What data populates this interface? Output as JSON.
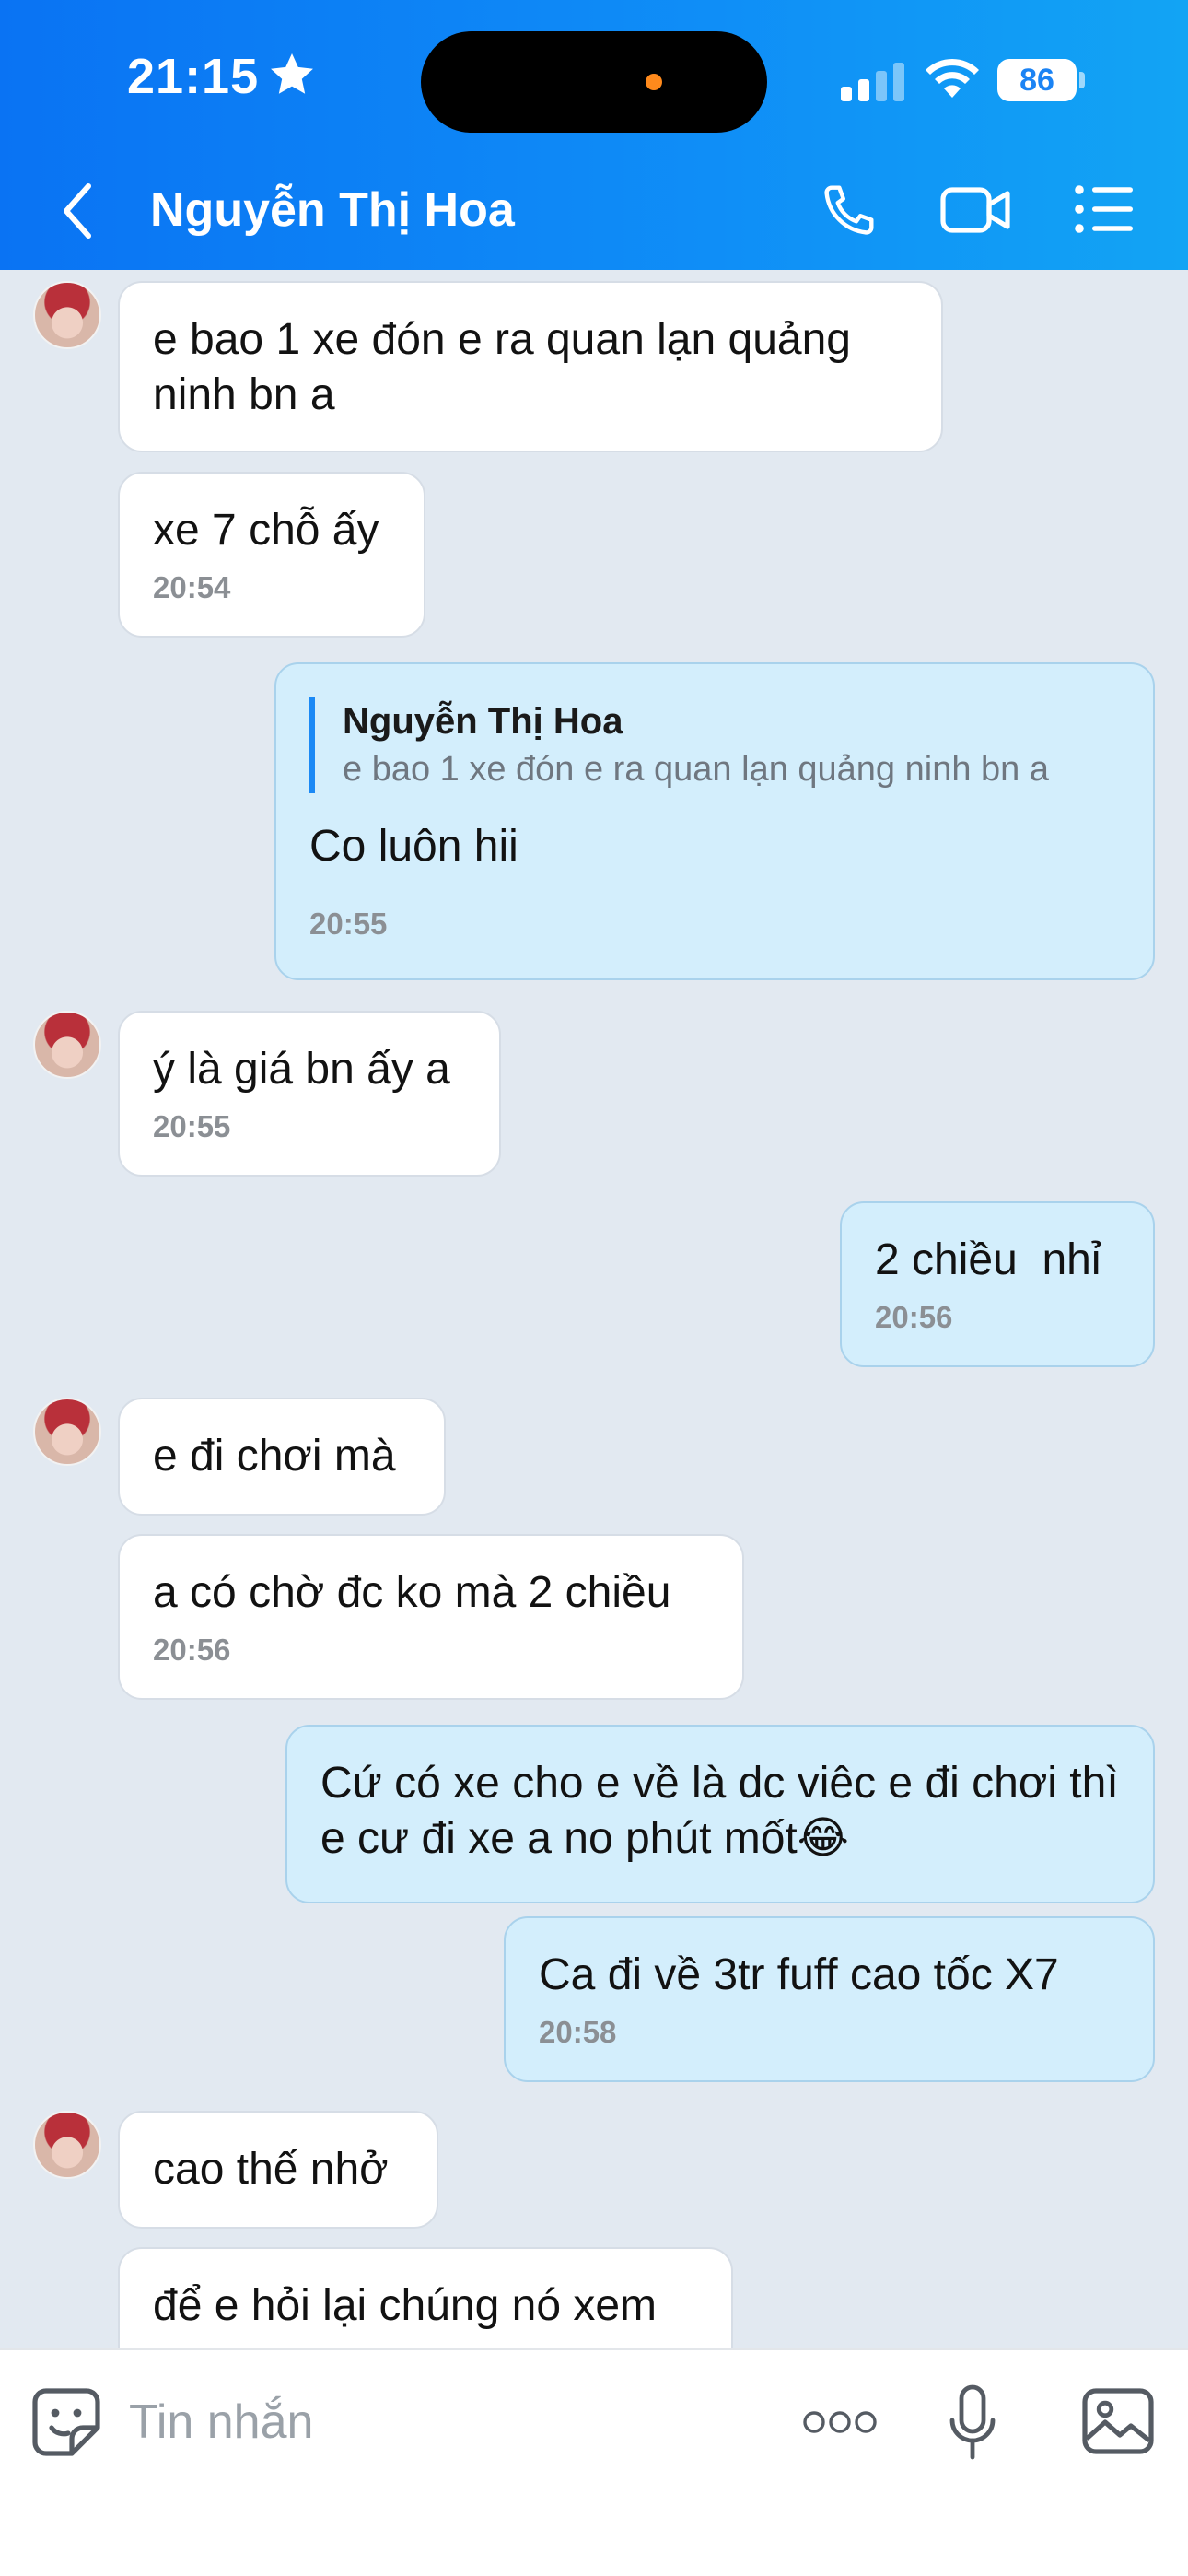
{
  "status_bar": {
    "time": "21:15",
    "battery": "86",
    "icons": [
      "star-icon",
      "signal-icon",
      "wifi-icon",
      "battery-icon"
    ]
  },
  "header": {
    "contact_name": "Nguyễn Thị Hoa",
    "icons": [
      "back-chevron-icon",
      "phone-icon",
      "video-camera-icon",
      "list-menu-icon"
    ]
  },
  "messages": [
    {
      "side": "in",
      "text": "e bao 1 xe đón e ra quan lạn quảng ninh bn a",
      "time": ""
    },
    {
      "side": "in",
      "text": "xe 7 chỗ ấy",
      "time": "20:54"
    },
    {
      "side": "out",
      "quote_name": "Nguyễn Thị Hoa",
      "quote_text": "e bao 1 xe đón e ra quan lạn quảng ninh bn a",
      "text": "Co luôn hii",
      "time": "20:55"
    },
    {
      "side": "in",
      "text": "ý là giá bn ấy a",
      "time": "20:55"
    },
    {
      "side": "out",
      "text": "2 chiều  nhỉ",
      "time": "20:56"
    },
    {
      "side": "in",
      "text": "e đi chơi mà",
      "time": ""
    },
    {
      "side": "in",
      "text": "a có chờ đc ko mà 2 chiều",
      "time": "20:56"
    },
    {
      "side": "out",
      "text": "Cứ có xe cho e về là dc viêc e đi chơi thì e cư đi xe a no phút mốt😂",
      "time": ""
    },
    {
      "side": "out",
      "text": "Ca đi về 3tr fuff cao tốc X7",
      "time": "20:58"
    },
    {
      "side": "in",
      "text": "cao thế nhở",
      "time": ""
    },
    {
      "side": "in",
      "text": "để e hỏi lại chúng nó xem",
      "time": ""
    }
  ],
  "composer": {
    "placeholder": "Tin nhắn",
    "icons": [
      "sticker-icon",
      "more-dots-icon",
      "microphone-icon",
      "image-icon"
    ]
  },
  "colors": {
    "header_start": "#0a73f3",
    "header_end": "#12a4f4",
    "chat_background": "#e2e9f1",
    "incoming_bubble": "#ffffff",
    "outgoing_bubble": "#d3eefc",
    "quote_bar": "#1b89f5"
  }
}
